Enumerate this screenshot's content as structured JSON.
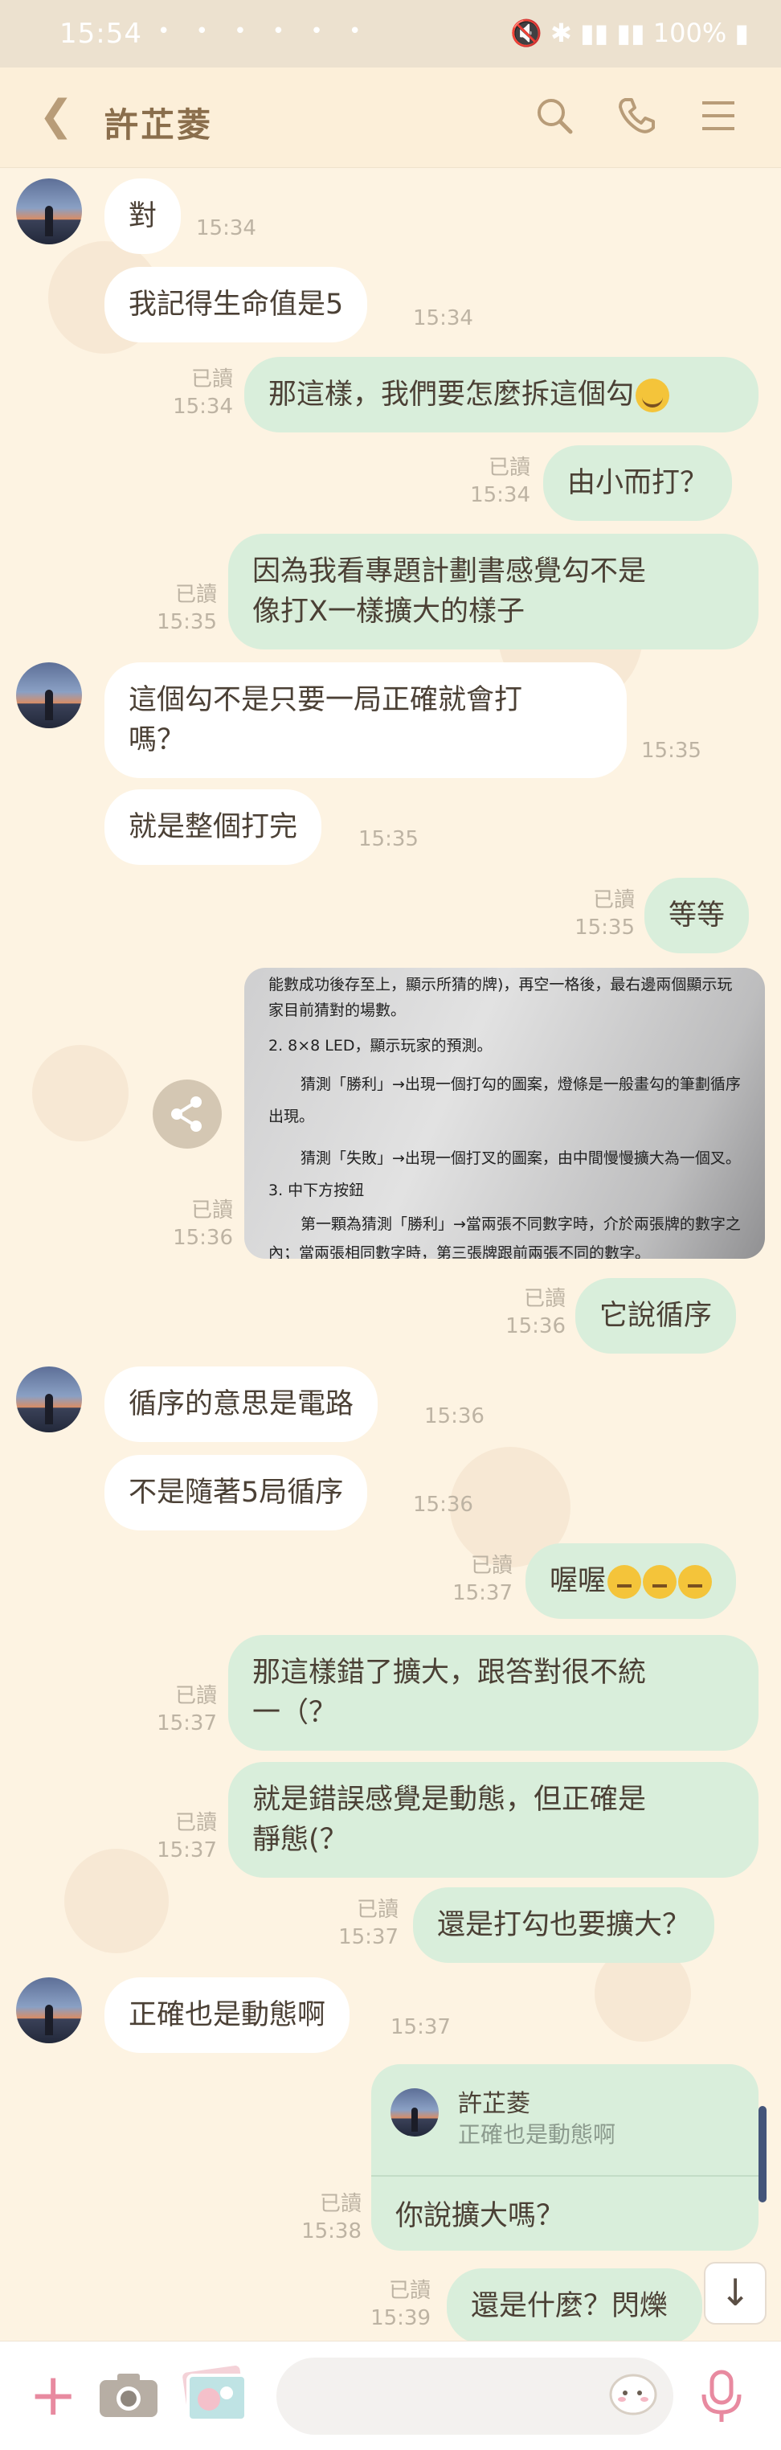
{
  "status_bar": {
    "time": "15:54",
    "dots": "• • • • • •",
    "right": "🔇 ✱ ▮▮ ▮▮ 100% ▮"
  },
  "header": {
    "title": "許芷菱",
    "icons": [
      "back-icon",
      "search-icon",
      "phone-icon",
      "menu-icon"
    ]
  },
  "messages": [
    {
      "side": "in",
      "text": "對",
      "time": "15:34"
    },
    {
      "side": "in",
      "text": "我記得生命值是5",
      "time": "15:34"
    },
    {
      "side": "out",
      "text": "那這樣，我們要怎麼拆這個勾",
      "read": "已讀",
      "time": "15:34",
      "emoji": "sweat-smile"
    },
    {
      "side": "out",
      "text": "由小而打？",
      "read": "已讀",
      "time": "15:34"
    },
    {
      "side": "out",
      "text": "因為我看專題計劃書感覺勾不是\n像打X一樣擴大的樣子",
      "read": "已讀",
      "time": "15:35"
    },
    {
      "side": "in",
      "text": "這個勾不是只要一局正確就會打\n嗎？",
      "time": "15:35"
    },
    {
      "side": "in",
      "text": "就是整個打完",
      "time": "15:35"
    },
    {
      "side": "out",
      "text": "等等",
      "read": "已讀",
      "time": "15:35"
    },
    {
      "side": "out",
      "type": "image",
      "read": "已讀",
      "time": "15:36"
    },
    {
      "side": "out",
      "text": "它說循序",
      "read": "已讀",
      "time": "15:36"
    },
    {
      "side": "in",
      "text": "循序的意思是電路",
      "time": "15:36"
    },
    {
      "side": "in",
      "text": "不是隨著5局循序",
      "time": "15:36"
    },
    {
      "side": "out",
      "text": "喔喔",
      "read": "已讀",
      "time": "15:37",
      "emoji": "thinking x3"
    },
    {
      "side": "out",
      "text": "那這樣錯了擴大，跟答對很不統\n一（？",
      "read": "已讀",
      "time": "15:37"
    },
    {
      "side": "out",
      "text": "就是錯誤感覺是動態，但正確是\n靜態(？",
      "read": "已讀",
      "time": "15:37"
    },
    {
      "side": "out",
      "text": "還是打勾也要擴大？",
      "read": "已讀",
      "time": "15:37"
    },
    {
      "side": "in",
      "text": "正確也是動態啊",
      "time": "15:37"
    },
    {
      "side": "out",
      "type": "reply",
      "quote_name": "許芷菱",
      "quote_text": "正確也是動態啊",
      "text": "你說擴大嗎？",
      "read": "已讀",
      "time": "15:38"
    },
    {
      "side": "out",
      "text": "還是什麼？閃爍",
      "read": "已讀",
      "time": "15:39"
    }
  ],
  "photo_lines": [
    "能數成功後存至上，顯示所猜的牌)，再空一格後，最右邊兩個顯示玩",
    "家目前猜對的場數。",
    "2.  8×8 LED，顯示玩家的預測。",
    "猜測「勝利」→出現一個打勾的圖案，燈條是一般畫勾的筆劃循序",
    "出現。",
    "猜測「失敗」→出現一個打叉的圖案，由中間慢慢擴大為一個叉。",
    "3.  中下方按鈕",
    "第一顆為猜測「勝利」→當兩張不同數字時，介於兩張牌的數字之",
    "內；當兩張相同數字時，第三張牌跟前兩張不同的數字。"
  ],
  "icons": {
    "down": "arrow-down-icon",
    "share": "share-icon",
    "plus": "plus-icon",
    "camera": "camera-icon",
    "gallery": "gallery-icon",
    "sticker": "sticker-icon",
    "mic": "mic-icon"
  },
  "colors": {
    "background": "#fdf3e2",
    "outgoing_bubble": "#d9eedb",
    "incoming_bubble": "#ffffff",
    "header": "#fcefd9",
    "accent_pink": "#e88aa0"
  }
}
